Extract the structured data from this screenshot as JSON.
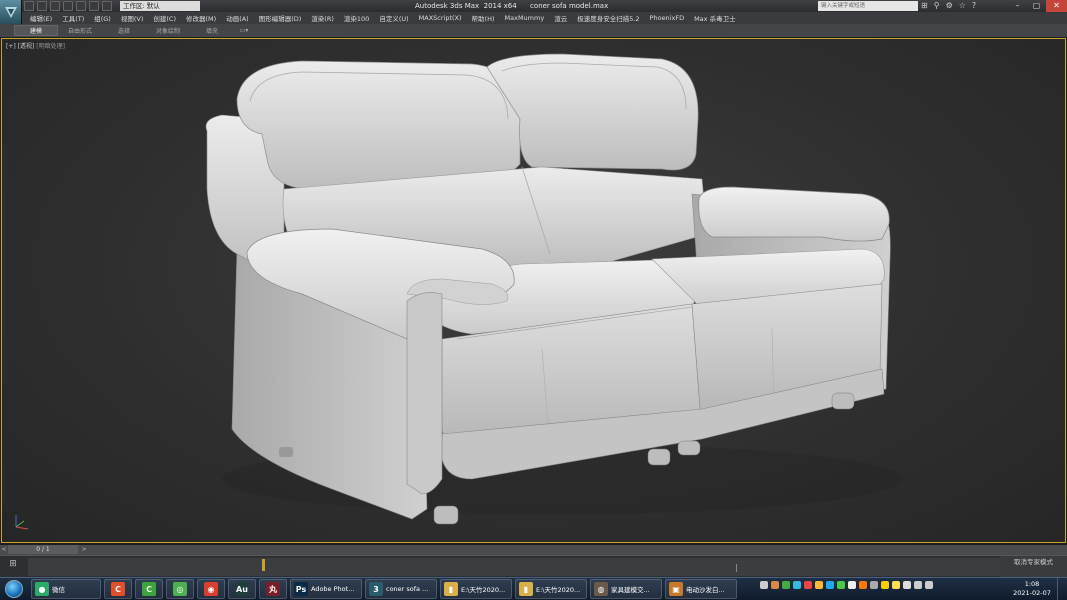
{
  "app": {
    "title": "Autodesk 3ds Max  2014 x64      coner sofa model.max",
    "workspace": "工作区: 默认",
    "search_placeholder": "键入关键字或短语"
  },
  "window_controls": {
    "minimize": "–",
    "restore": "▢",
    "close": "✕"
  },
  "menubar": [
    "编辑(E)",
    "工具(T)",
    "组(G)",
    "视图(V)",
    "创建(C)",
    "修改器(M)",
    "动画(A)",
    "图形编辑器(D)",
    "渲染(R)",
    "渲染100",
    "自定义(U)",
    "MAXScript(X)",
    "帮助(H)",
    "MaxMummy",
    "渲云",
    "极速度身安全扫描5.2",
    "PhoenixFD",
    "Max 杀毒卫士"
  ],
  "ribbon_tabs": [
    "建模",
    "自由形式",
    "选择",
    "对象绘制",
    "填充"
  ],
  "viewport": {
    "label_plus": "[+]",
    "label_view": "[透视]",
    "label_shading": "[明暗处理]"
  },
  "timeline": {
    "frame": "0 / 1",
    "left_arrow": "<",
    "right_arrow": ">"
  },
  "trackbar": {
    "left_icon": "⊞"
  },
  "status": {
    "expert_mode": "取消专家模式"
  },
  "taskbar": {
    "items": [
      {
        "label": "微信",
        "icon": "wechat-icon",
        "color": "#2aae67"
      },
      {
        "label": "",
        "icon": "camtasia-icon",
        "color": "#e0512b"
      },
      {
        "label": "",
        "icon": "camtasia-green-icon",
        "color": "#3da53d"
      },
      {
        "label": "",
        "icon": "green-circle-icon",
        "color": "#4caf50"
      },
      {
        "label": "",
        "icon": "chrome-icon",
        "color": "#d93f2f"
      },
      {
        "label": "",
        "icon": "audition-icon",
        "color": "#1f3d3a"
      },
      {
        "label": "",
        "icon": "red-app-icon",
        "color": "#7a1f2a"
      },
      {
        "label": "Adobe Phot...",
        "icon": "photoshop-icon",
        "color": "#0b2a47"
      },
      {
        "label": "coner sofa ...",
        "icon": "3dsmax-icon",
        "color": "#2a5c6b"
      },
      {
        "label": "E:\\天竹2020...",
        "icon": "folder-icon",
        "color": "#d9b04a"
      },
      {
        "label": "E:\\天竹2020...",
        "icon": "folder-icon",
        "color": "#d9b04a"
      },
      {
        "label": "家具建模交...",
        "icon": "group-icon",
        "color": "#6b5a4a"
      },
      {
        "label": "电动沙发白...",
        "icon": "image-viewer-icon",
        "color": "#c77a2a"
      }
    ],
    "clock_time": "1:08",
    "clock_date": "2021-02-07"
  },
  "colors": {
    "viewport_border": "#c9a227",
    "sofa": "#d9d9d9"
  }
}
